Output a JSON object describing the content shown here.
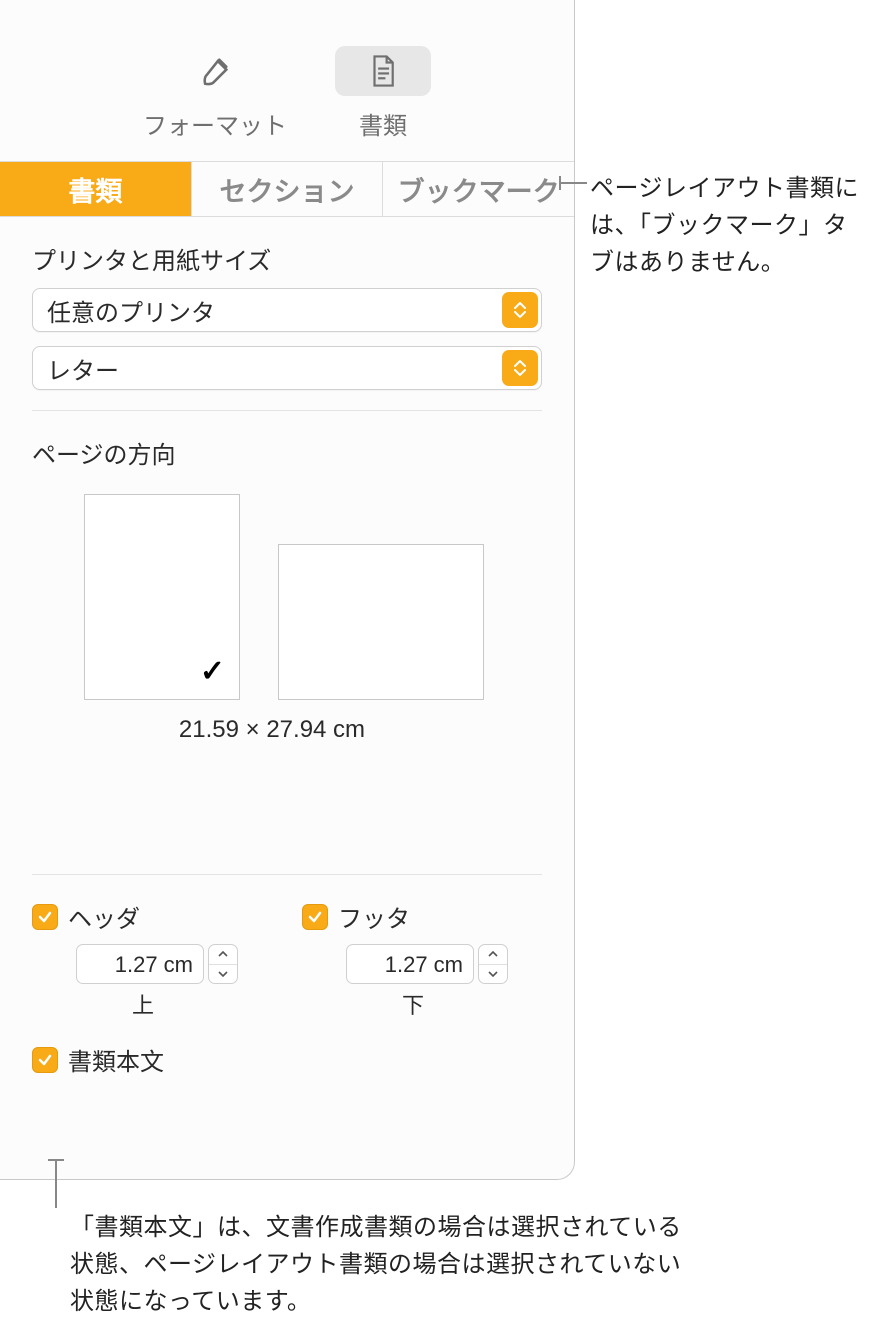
{
  "topbar": {
    "format_label": "フォーマット",
    "document_label": "書類"
  },
  "tabs": {
    "document": "書類",
    "section": "セクション",
    "bookmark": "ブックマーク"
  },
  "printer_section": {
    "title": "プリンタと用紙サイズ",
    "printer_value": "任意のプリンタ",
    "paper_value": "レター"
  },
  "orientation": {
    "title": "ページの方向",
    "dimensions": "21.59 × 27.94 cm"
  },
  "header_footer": {
    "header_label": "ヘッダ",
    "footer_label": "フッタ",
    "header_value": "1.27 cm",
    "footer_value": "1.27 cm",
    "top_label": "上",
    "bottom_label": "下"
  },
  "body_checkbox": {
    "label": "書類本文"
  },
  "callouts": {
    "bookmark_note": "ページレイアウト書類には、「ブックマーク」タブはありません。",
    "body_note": "「書類本文」は、文書作成書類の場合は選択されている状態、ページレイアウト書類の場合は選択されていない状態になっています。"
  }
}
